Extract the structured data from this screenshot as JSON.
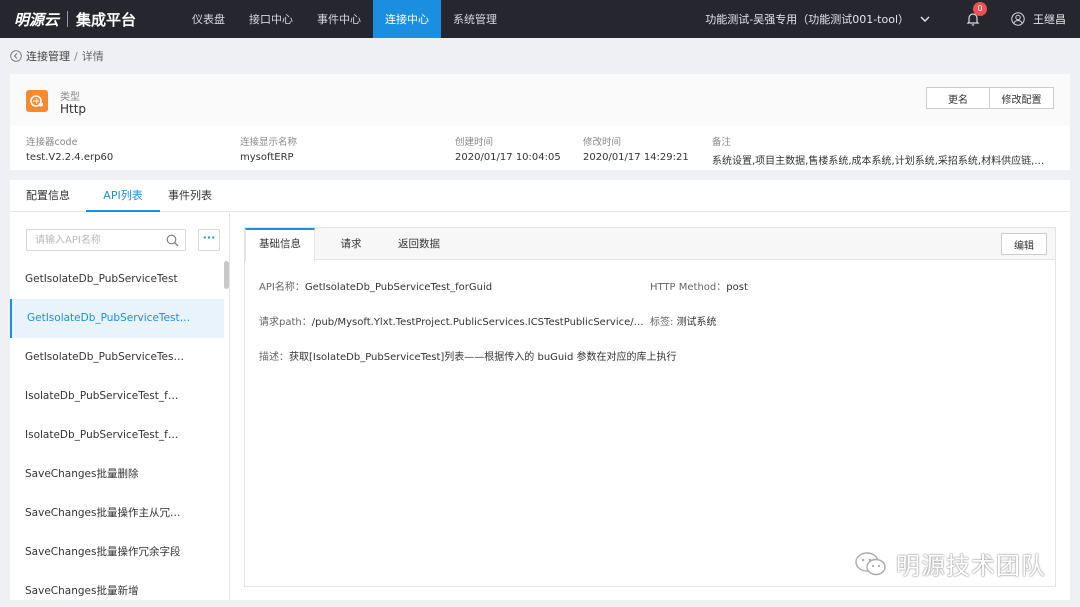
{
  "brand": {
    "logo": "明源云",
    "product": "集成平台"
  },
  "nav": [
    {
      "label": "仪表盘"
    },
    {
      "label": "接口中心"
    },
    {
      "label": "事件中心"
    },
    {
      "label": "连接中心"
    },
    {
      "label": "系统管理"
    }
  ],
  "nav_active_index": 3,
  "header_right": {
    "tenant": "功能测试-吴强专用（功能测试001-tool）",
    "notifications": "0",
    "user": "王继昌"
  },
  "breadcrumb": {
    "parent": "连接管理",
    "separator": "/",
    "current": "详情"
  },
  "connector": {
    "type_label": "类型",
    "type_value": "Http",
    "rename_button": "更名",
    "config_button": "修改配置",
    "meta": [
      {
        "label": "连接器code",
        "value": "test.V2.2.4.erp60"
      },
      {
        "label": "连接显示名称",
        "value": "mysoftERP"
      },
      {
        "label": "创建时间",
        "value": "2020/01/17 10:04:05"
      },
      {
        "label": "修改时间",
        "value": "2020/01/17 14:29:21"
      },
      {
        "label": "备注",
        "value": "系统设置,项目主数据,售楼系统,成本系统,计划系统,采招系统,材料供应链,…"
      }
    ]
  },
  "tabs": [
    {
      "label": "配置信息"
    },
    {
      "label": "API列表"
    },
    {
      "label": "事件列表"
    }
  ],
  "api_list": {
    "search_placeholder": "请输入API名称",
    "more_label": "···",
    "items": [
      "GetIsolateDb_PubServiceTest",
      "GetIsolateDb_PubServiceTest…",
      "GetIsolateDb_PubServiceTes…",
      "IsolateDb_PubServiceTest_f…",
      "IsolateDb_PubServiceTest_f…",
      "SaveChanges批量删除",
      "SaveChanges批量操作主从冗…",
      "SaveChanges批量操作冗余字段",
      "SaveChanges批量新增"
    ],
    "active_index": 1
  },
  "detail": {
    "subtabs": [
      {
        "label": "基础信息"
      },
      {
        "label": "请求"
      },
      {
        "label": "返回数据"
      }
    ],
    "edit_button": "编辑",
    "api_name_label": "API名称：",
    "api_name": "GetIsolateDb_PubServiceTest_forGuid",
    "http_method_label": "HTTP Method：",
    "http_method": "post",
    "path_label": "请求path：",
    "path": "/pub/Mysoft.Ylxt.TestProject.PublicServices.ICSTestPublicService/Ge…",
    "tag_label": "标签:",
    "tag": "测试系统",
    "desc_label": "描述：",
    "desc": "获取[IsolateDb_PubServiceTest]列表——根据传入的 buGuid 参数在对应的库上执行"
  },
  "watermark": "明源技术团队",
  "colors": {
    "primary": "#1a8fe0",
    "nav_bg": "#26272e",
    "type_icon": "#f58a2e",
    "badge": "#f05050"
  }
}
